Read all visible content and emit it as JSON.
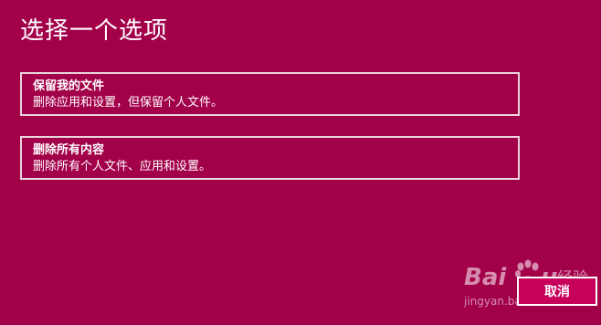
{
  "page": {
    "title": "选择一个选项"
  },
  "options": [
    {
      "title": "保留我的文件",
      "description": "删除应用和设置，但保留个人文件。"
    },
    {
      "title": "删除所有内容",
      "description": "删除所有个人文件、应用和设置。"
    }
  ],
  "footer": {
    "cancel_label": "取消"
  },
  "watermark": {
    "brand": "Baidu 经验",
    "url": "jingyan.baidu.com"
  },
  "colors": {
    "background": "#a3004a",
    "button_background": "#c7005c",
    "text": "#ffffff",
    "option_border": "#e9d5dd"
  }
}
